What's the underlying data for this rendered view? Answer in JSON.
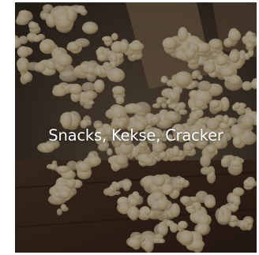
{
  "category_tile": {
    "title": "Snacks, Kekse, Cracker",
    "image": "popcorn-photo",
    "text_color": "#ffffff"
  }
}
